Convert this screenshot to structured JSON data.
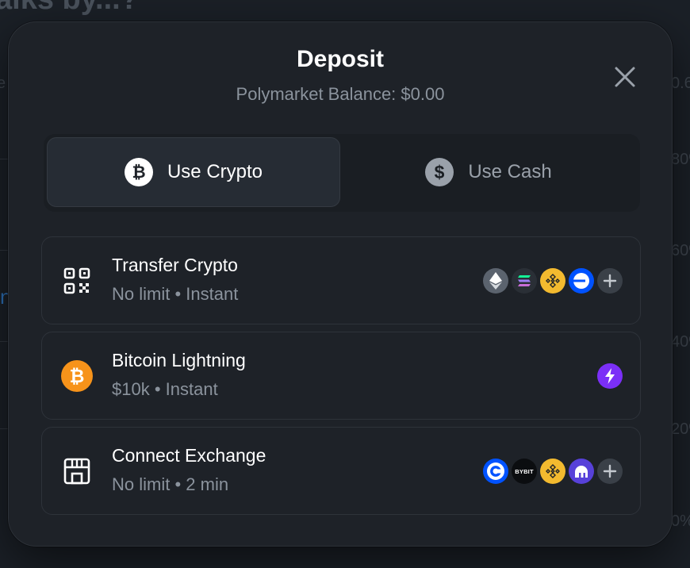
{
  "background": {
    "title_fragment": "alks by...?",
    "left_fragment": "e",
    "ticks": [
      "0.6",
      "80%",
      "60%",
      "40%",
      "20%",
      "0%"
    ]
  },
  "modal": {
    "title": "Deposit",
    "subtitle": "Polymarket Balance: $0.00",
    "close_icon": "close-icon"
  },
  "tabs": [
    {
      "label": "Use Crypto",
      "icon": "bitcoin-icon",
      "active": true
    },
    {
      "label": "Use Cash",
      "icon": "dollar-icon",
      "active": false
    }
  ],
  "options": [
    {
      "title": "Transfer Crypto",
      "subtitle": "No limit • Instant",
      "icon": "qr-code-icon",
      "badges": [
        "ethereum-icon",
        "solana-icon",
        "bnb-icon",
        "base-icon",
        "plus-icon"
      ]
    },
    {
      "title": "Bitcoin Lightning",
      "subtitle": "$10k • Instant",
      "icon": "bitcoin-icon",
      "badges": [
        "lightning-icon"
      ]
    },
    {
      "title": "Connect Exchange",
      "subtitle": "No limit • 2 min",
      "icon": "storefront-icon",
      "badges": [
        "coinbase-icon",
        "bybit-icon",
        "binance-icon",
        "kraken-icon",
        "plus-icon"
      ]
    }
  ],
  "badge_text": {
    "bybit": "BYBIT"
  },
  "colors": {
    "bitcoin_orange": "#f7931a",
    "bnb_yellow": "#f3ba2f",
    "base_blue": "#0052ff",
    "coinbase_blue": "#0052ff",
    "kraken_purple": "#5741d9",
    "lightning_purple": "#7b2ff7"
  }
}
